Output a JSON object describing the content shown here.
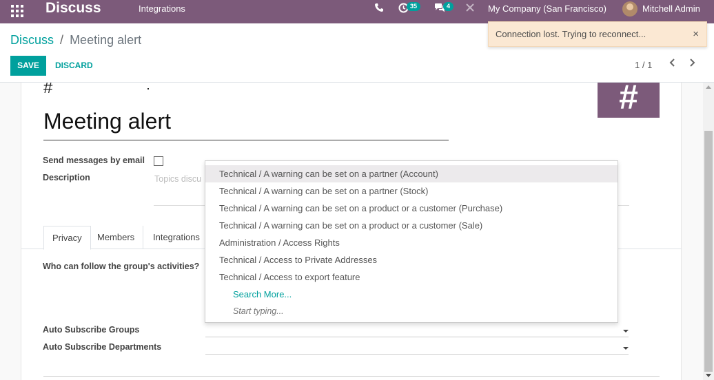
{
  "navbar": {
    "app_name": "Discuss",
    "menu_items": [
      "Integrations"
    ],
    "activity_count": "35",
    "message_count": "4",
    "company": "My Company (San Francisco)",
    "user": "Mitchell Admin",
    "icons": [
      "apps-grid-icon",
      "phone-icon",
      "activity-clock-icon",
      "chat-bubbles-icon",
      "debug-bug-icon"
    ],
    "color": "#7c5a7a"
  },
  "breadcrumb": {
    "parent": "Discuss",
    "separator": "/",
    "current": "Meeting alert"
  },
  "buttons": {
    "save": "SAVE",
    "discard": "DISCARD"
  },
  "pager": {
    "value": "1 / 1"
  },
  "notification": {
    "message": "Connection lost. Trying to reconnect...",
    "close": "×"
  },
  "form": {
    "prefix": "#",
    "name": "Meeting alert",
    "image_glyph": "#",
    "send_email_label": "Send messages by email",
    "send_email_checked": false,
    "description_label": "Description",
    "description_placeholder": "Topics discu",
    "tabs": [
      "Privacy",
      "Members",
      "Integrations"
    ],
    "active_tab": "Privacy",
    "follow_label": "Who can follow the group's activities?",
    "auto_groups_label": "Auto Subscribe Groups",
    "auto_departments_label": "Auto Subscribe Departments"
  },
  "dropdown": {
    "items": [
      "Technical / A warning can be set on a partner (Account)",
      "Technical / A warning can be set on a partner (Stock)",
      "Technical / A warning can be set on a product or a customer (Purchase)",
      "Technical / A warning can be set on a product or a customer (Sale)",
      "Administration / Access Rights",
      "Technical / Access to Private Addresses",
      "Technical / Access to export feature"
    ],
    "highlighted_index": 0,
    "search_more": "Search More...",
    "start_typing": "Start typing..."
  },
  "accent_color": "#00a09d"
}
